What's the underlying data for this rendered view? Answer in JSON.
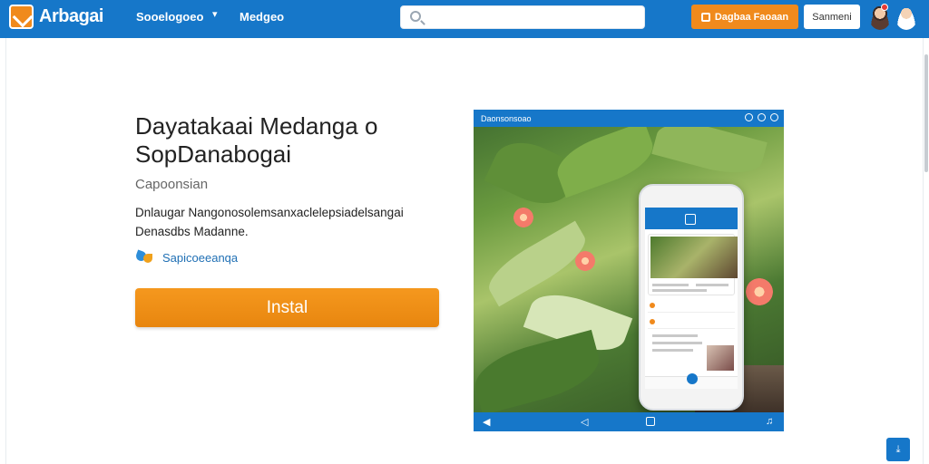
{
  "header": {
    "brand": "Arbagai",
    "nav_dropdown": "Sooelogoeo",
    "nav_caret": "▾",
    "nav_media": "Medgeo",
    "search_placeholder": "",
    "primary_button": "Dagbaa Faoaan",
    "secondary_button": "Sanmeni"
  },
  "app": {
    "title": "Dayatakaai Medanga o SopDanabogai",
    "category": "Capoonsian",
    "description": "Dnlaugar Nangonosolemsanxaclelepsiadelsangai Denasdbs Madanne.",
    "developer": "Sapicoeeanqa",
    "install_label": "Instal"
  },
  "preview": {
    "status_text": "Daonsonsoao"
  },
  "colors": {
    "brand_blue": "#1677c9",
    "accent_orange": "#f08a1c"
  },
  "icons": [
    "logo-icon",
    "search-icon",
    "user-avatar",
    "developer-icon",
    "back-arrow-icon",
    "home-square-icon",
    "corner-action-icon"
  ]
}
